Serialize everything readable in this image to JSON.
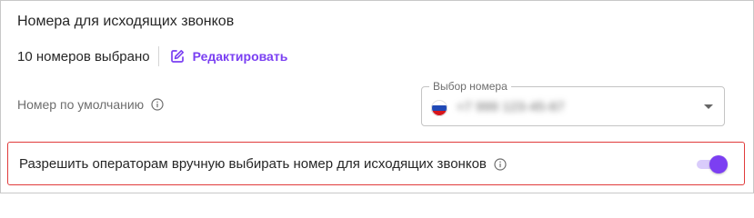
{
  "outgoing": {
    "title": "Номера для исходящих звонков",
    "count_label": "10 номеров выбрано",
    "edit_label": "Редактировать"
  },
  "default_number": {
    "label": "Номер по умолчанию",
    "select_legend": "Выбор номера",
    "value": "+7 999 123-45-67"
  },
  "permission": {
    "label": "Разрешить операторам вручную выбирать номер для исходящих звонков",
    "toggle_on": true
  },
  "colors": {
    "accent": "#7c3ff2",
    "highlight_border": "#e03b3b"
  },
  "icons": [
    "edit-icon",
    "info-icon",
    "russia-flag-icon",
    "chevron-down-icon"
  ]
}
